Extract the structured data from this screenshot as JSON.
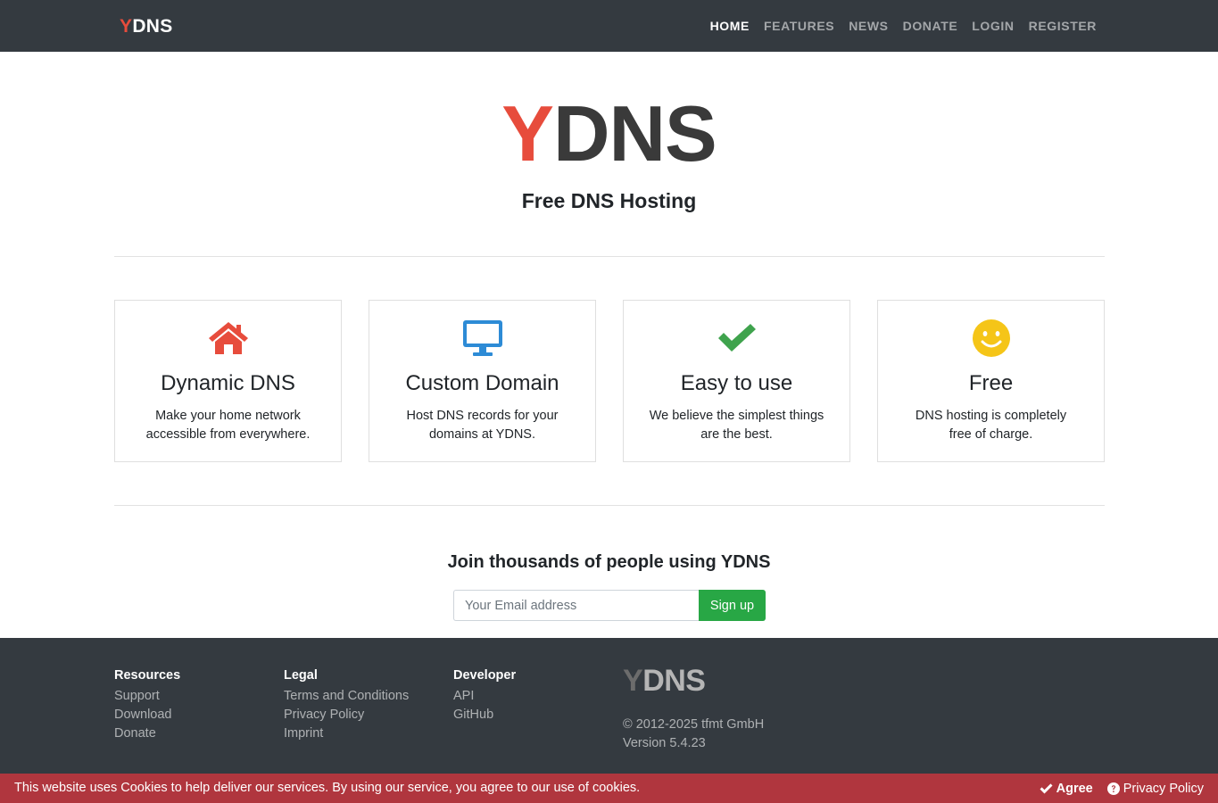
{
  "navbar": {
    "brand_y": "Y",
    "brand_rest": "DNS",
    "items": [
      {
        "label": "HOME",
        "active": true
      },
      {
        "label": "FEATURES",
        "active": false
      },
      {
        "label": "NEWS",
        "active": false
      },
      {
        "label": "DONATE",
        "active": false
      },
      {
        "label": "LOGIN",
        "active": false
      },
      {
        "label": "REGISTER",
        "active": false
      }
    ]
  },
  "hero": {
    "title_y": "Y",
    "title_rest": "DNS",
    "subtitle": "Free DNS Hosting"
  },
  "features": [
    {
      "icon": "home-icon",
      "title": "Dynamic DNS",
      "text": "Make your home network accessible from everywhere.",
      "color": "#e74c3c"
    },
    {
      "icon": "desktop-icon",
      "title": "Custom Domain",
      "text": "Host DNS records for your domains at YDNS.",
      "color": "#2d8bd6"
    },
    {
      "icon": "check-icon",
      "title": "Easy to use",
      "text": "We believe the simplest things are the best.",
      "color": "#3fa34d"
    },
    {
      "icon": "smile-icon",
      "title": "Free",
      "text": "DNS hosting is completely free of charge.",
      "color": "#f5c518"
    }
  ],
  "signup": {
    "title": "Join thousands of people using YDNS",
    "email_placeholder": "Your Email address",
    "button_label": "Sign up"
  },
  "footer": {
    "columns": [
      {
        "heading": "Resources",
        "links": [
          "Support",
          "Download",
          "Donate"
        ]
      },
      {
        "heading": "Legal",
        "links": [
          "Terms and Conditions",
          "Privacy Policy",
          "Imprint"
        ]
      },
      {
        "heading": "Developer",
        "links": [
          "API",
          "GitHub"
        ]
      }
    ],
    "logo_y": "Y",
    "logo_rest": "DNS",
    "copyright": "© 2012-2025 tfmt GmbH",
    "version": "Version 5.4.23"
  },
  "cookie": {
    "message": "This website uses Cookies to help deliver our services. By using our service, you agree to our use of cookies.",
    "agree_label": "Agree",
    "privacy_label": "Privacy Policy"
  },
  "colors": {
    "brand_red": "#e74c3c",
    "navbar_bg": "#343a40",
    "signup_green": "#28a745",
    "cookie_bg": "#b0363e"
  }
}
